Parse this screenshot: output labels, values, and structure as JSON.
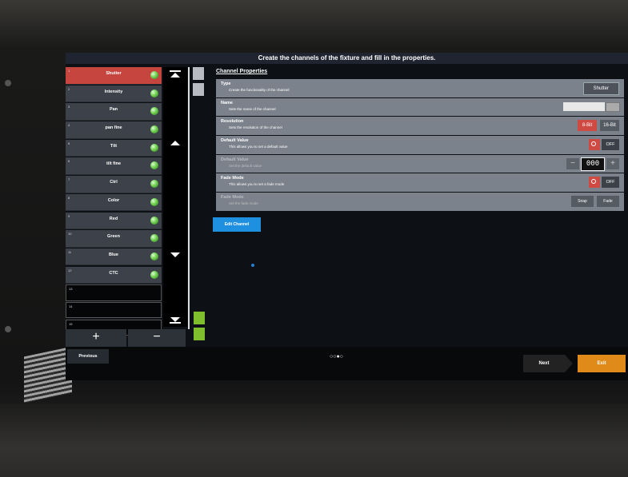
{
  "header": {
    "title": "Create the channels of the fixture and fill in the properties."
  },
  "channels": [
    {
      "num": "1",
      "name": "Shutter",
      "selected": true
    },
    {
      "num": "2",
      "name": "Intensity"
    },
    {
      "num": "3",
      "name": "Pan"
    },
    {
      "num": "4",
      "name": "pan fine"
    },
    {
      "num": "5",
      "name": "Tilt"
    },
    {
      "num": "6",
      "name": "tilt fine"
    },
    {
      "num": "7",
      "name": "Ctrl"
    },
    {
      "num": "8",
      "name": "Color"
    },
    {
      "num": "9",
      "name": "Red"
    },
    {
      "num": "10",
      "name": "Green"
    },
    {
      "num": "11",
      "name": "Blue"
    },
    {
      "num": "12",
      "name": "CTC"
    }
  ],
  "empty_channels": [
    "13",
    "14",
    "15"
  ],
  "list_buttons": {
    "add": "+",
    "remove": "−"
  },
  "properties": {
    "title": "Channel Properties",
    "rows": {
      "type": {
        "label": "Type",
        "desc": "Create the functionality of the channel",
        "value": "Shutter"
      },
      "name": {
        "label": "Name",
        "desc": "Sets the name of the channel"
      },
      "resolution": {
        "label": "Resolution",
        "desc": "Sets the resolution of the channel",
        "opt1": "8-Bit",
        "opt2": "16-Bit"
      },
      "default": {
        "label": "Default Value",
        "desc": "This allows you to set a default value",
        "toggle": "OFF"
      },
      "default2": {
        "label": "Default Value",
        "desc": "Set the default value",
        "value": "000",
        "minus": "−",
        "plus": "+"
      },
      "fade": {
        "label": "Fade Mode",
        "desc": "This allows you to set a fade mode",
        "toggle": "OFF"
      },
      "fade2": {
        "label": "Fade Mode",
        "desc": "Set the fade mode",
        "opt1": "Snap",
        "opt2": "Fade"
      }
    }
  },
  "edit_button": "Edit Channel",
  "footer": {
    "previous": "Previous",
    "dots": "○○●○",
    "next": "Next",
    "exit": "Exit"
  },
  "colors": {
    "accent_red": "#c7453f",
    "accent_orange": "#e08a1a",
    "accent_blue": "#1f8fe0"
  }
}
